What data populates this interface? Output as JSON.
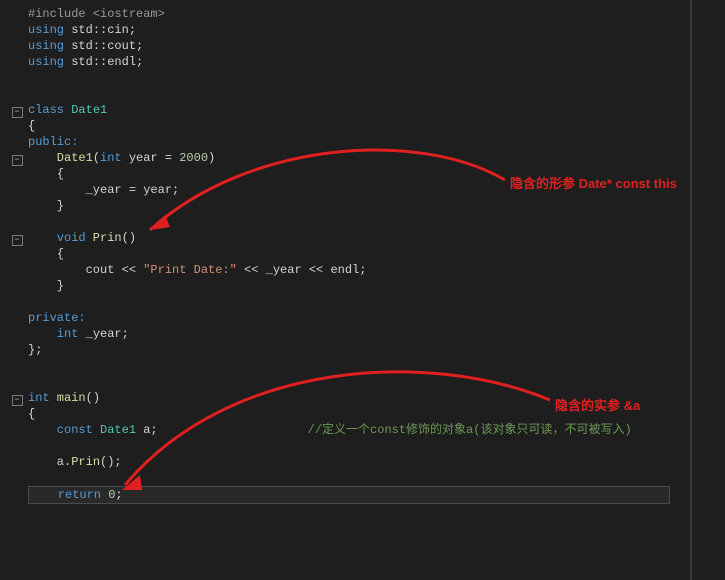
{
  "code": {
    "l1_include_kw": "#include",
    "l1_include_hdr": " <iostream>",
    "l2_using": "using",
    "l2_rest": " std::cin;",
    "l3_using": "using",
    "l3_rest": " std::cout;",
    "l4_using": "using",
    "l4_rest": " std::endl;",
    "l6_class": "class",
    "l6_name": " Date1",
    "l7": "{",
    "l8_public": "public:",
    "l9_ctor": "    Date1",
    "l9_sig1": "(",
    "l9_int": "int",
    "l9_sig2": " year = ",
    "l9_num": "2000",
    "l9_sig3": ")",
    "l10": "    {",
    "l11": "        _year = year;",
    "l12": "    }",
    "l14_void": "    void",
    "l14_name": " Prin",
    "l14_par": "()",
    "l15": "    {",
    "l16a": "        cout << ",
    "l16s": "\"Print Date:\"",
    "l16b": " << _year << endl;",
    "l17": "    }",
    "l19_private": "private:",
    "l20_int": "    int",
    "l20_rest": " _year;",
    "l21": "};",
    "l24_int": "int",
    "l24_main": " main",
    "l24_par": "()",
    "l25": "{",
    "l26a_const": "    const",
    "l26a_type": " Date1",
    "l26a_rest": " a;",
    "l26_cmt": "//定义一个const修饰的对象a(该对象只可读，不可被写入)",
    "l28a": "    a.",
    "l28b": "Prin",
    "l28c": "();",
    "l30_ret": "    return",
    "l30_num": " 0",
    "l30_semi": ";"
  },
  "annotations": {
    "formal_param": "隐含的形参 Date* const this",
    "actual_param": "隐含的实参 &a"
  }
}
